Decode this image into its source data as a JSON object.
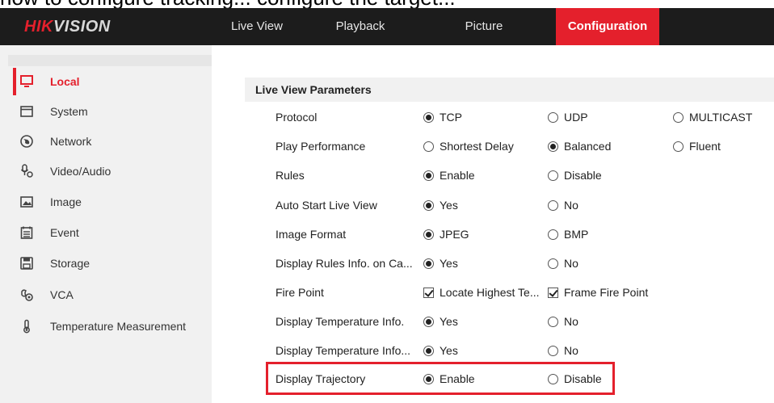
{
  "caption": "how to configure tracking... configure the target...",
  "brand": {
    "part1": "HIK",
    "part2": "VISION"
  },
  "nav": {
    "items": [
      {
        "label": "Live View",
        "active": false
      },
      {
        "label": "Playback",
        "active": false
      },
      {
        "label": "Picture",
        "active": false
      },
      {
        "label": "Configuration",
        "active": true
      }
    ]
  },
  "sidebar": {
    "items": [
      {
        "label": "Local",
        "icon": "monitor-icon",
        "active": true
      },
      {
        "label": "System",
        "icon": "system-window-icon",
        "active": false
      },
      {
        "label": "Network",
        "icon": "globe-icon",
        "active": false
      },
      {
        "label": "Video/Audio",
        "icon": "microphone-icon",
        "active": false
      },
      {
        "label": "Image",
        "icon": "picture-icon",
        "active": false
      },
      {
        "label": "Event",
        "icon": "calendar-icon",
        "active": false
      },
      {
        "label": "Storage",
        "icon": "floppy-disk-icon",
        "active": false
      },
      {
        "label": "VCA",
        "icon": "vca-icon",
        "active": false
      },
      {
        "label": "Temperature Measurement",
        "icon": "thermometer-icon",
        "active": false
      }
    ]
  },
  "section": {
    "title": "Live View Parameters"
  },
  "params": [
    {
      "name": "Protocol",
      "options": [
        {
          "type": "radio",
          "label": "TCP",
          "checked": true
        },
        {
          "type": "radio",
          "label": "UDP",
          "checked": false
        },
        {
          "type": "radio",
          "label": "MULTICAST",
          "checked": false
        }
      ]
    },
    {
      "name": "Play Performance",
      "options": [
        {
          "type": "radio",
          "label": "Shortest Delay",
          "checked": false
        },
        {
          "type": "radio",
          "label": "Balanced",
          "checked": true
        },
        {
          "type": "radio",
          "label": "Fluent",
          "checked": false
        }
      ]
    },
    {
      "name": "Rules",
      "options": [
        {
          "type": "radio",
          "label": "Enable",
          "checked": true
        },
        {
          "type": "radio",
          "label": "Disable",
          "checked": false
        }
      ]
    },
    {
      "name": "Auto Start Live View",
      "options": [
        {
          "type": "radio",
          "label": "Yes",
          "checked": true
        },
        {
          "type": "radio",
          "label": "No",
          "checked": false
        }
      ]
    },
    {
      "name": "Image Format",
      "options": [
        {
          "type": "radio",
          "label": "JPEG",
          "checked": true
        },
        {
          "type": "radio",
          "label": "BMP",
          "checked": false
        }
      ]
    },
    {
      "name": "Display Rules Info. on Ca...",
      "options": [
        {
          "type": "radio",
          "label": "Yes",
          "checked": true
        },
        {
          "type": "radio",
          "label": "No",
          "checked": false
        }
      ]
    },
    {
      "name": "Fire Point",
      "options": [
        {
          "type": "check",
          "label": "Locate Highest Te...",
          "checked": true
        },
        {
          "type": "check",
          "label": "Frame Fire Point",
          "checked": true
        }
      ]
    },
    {
      "name": "Display Temperature Info.",
      "options": [
        {
          "type": "radio",
          "label": "Yes",
          "checked": true
        },
        {
          "type": "radio",
          "label": "No",
          "checked": false
        }
      ]
    },
    {
      "name": "Display Temperature Info...",
      "options": [
        {
          "type": "radio",
          "label": "Yes",
          "checked": true
        },
        {
          "type": "radio",
          "label": "No",
          "checked": false
        }
      ]
    },
    {
      "name": "Display Trajectory",
      "options": [
        {
          "type": "radio",
          "label": "Enable",
          "checked": true
        },
        {
          "type": "radio",
          "label": "Disable",
          "checked": false
        }
      ]
    }
  ],
  "colors": {
    "accent": "#e4202c",
    "header_bg": "#1c1c1c",
    "sidebar_bg": "#f1f1f1"
  }
}
